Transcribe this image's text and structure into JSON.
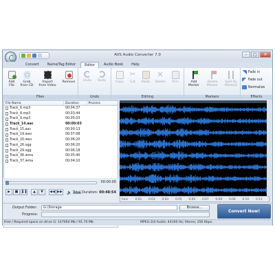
{
  "window": {
    "title": "AVS Audio Converter 7.0",
    "controls": {
      "min": "–",
      "max": "□",
      "close": "✕"
    }
  },
  "tabs": [
    "Convert",
    "Name/Tag Editor",
    "Editor",
    "Audio Book",
    "Help"
  ],
  "active_tab": "Editor",
  "ribbon": {
    "files": {
      "label": "Files",
      "add": "Add\nFile",
      "grab": "Grab\nfrom CD",
      "import": "Import\nfrom Video",
      "remove": "Remove"
    },
    "undo": {
      "label": "Undo",
      "undo": "Undo",
      "redo": "Redo"
    },
    "editing": {
      "label": "Editing",
      "copy": "Copy",
      "cut": "Cut",
      "paste": "Paste",
      "delete": "Delete",
      "trim": "Trim"
    },
    "markers": {
      "label": "Markers",
      "add": "Add\nMarker",
      "delete": "Delete\nMarker",
      "split": "Split By\nMarkers"
    },
    "effects": {
      "label": "Effects",
      "fade_in": "Fade in",
      "fade_out": "Fade out",
      "normalize": "Normalize"
    }
  },
  "file_list": {
    "columns": [
      "File Name",
      "Duration",
      "Process"
    ],
    "rows": [
      {
        "name": "Track_6.mp3",
        "duration": "00:04:37",
        "bold": false
      },
      {
        "name": "Track_8.mp3",
        "duration": "00:03:44",
        "bold": false
      },
      {
        "name": "Track_9.mp3",
        "duration": "00:05:03",
        "bold": false
      },
      {
        "name": "Track_14.aac",
        "duration": "00:00:03",
        "bold": true
      },
      {
        "name": "Track_15.aac",
        "duration": "00:00:13",
        "bold": false
      },
      {
        "name": "Track_19.wav",
        "duration": "00:07:08",
        "bold": false
      },
      {
        "name": "Track_20.wav",
        "duration": "00:06:20",
        "bold": false
      },
      {
        "name": "Track_26.ogg",
        "duration": "00:06:20",
        "bold": false
      },
      {
        "name": "Track_29.ogg",
        "duration": "00:06:18",
        "bold": false
      },
      {
        "name": "Track_36.wma",
        "duration": "00:05:40",
        "bold": false
      },
      {
        "name": "Track_37.wma",
        "duration": "00:04:10",
        "bold": false
      }
    ]
  },
  "waveform": {
    "channels": 8,
    "color": "#2f7fe6",
    "ruler_labels": [
      "hms",
      "0:02",
      "0:03",
      "0:04",
      "0:05",
      "0:06",
      "0:07",
      "0:08",
      "0:09",
      "0:10",
      "0:11"
    ],
    "db_labels": [
      "dB",
      "dB"
    ]
  },
  "player": {
    "position": "00:00:00",
    "total_duration_label": "Total Duration:",
    "total_duration": "00:48:54",
    "buttons": {
      "play": "▶",
      "stop": "■",
      "pause": "❚❚",
      "prev": "◀◀",
      "next": "▶▶",
      "up": "▲",
      "down": "▼"
    }
  },
  "output": {
    "folder_label": "Output Folder:",
    "folder_value": "G:\\Storage",
    "progress_label": "Progress:",
    "browse_label": "Browse...",
    "convert_label": "Convert Now!"
  },
  "status": {
    "left": "Free / Required space on drive  G: 147064 Mb / 91.70 Mb",
    "right": "MPEG-2/4 Audio: 44100 Hz; Stereo; 256 Kbps."
  }
}
